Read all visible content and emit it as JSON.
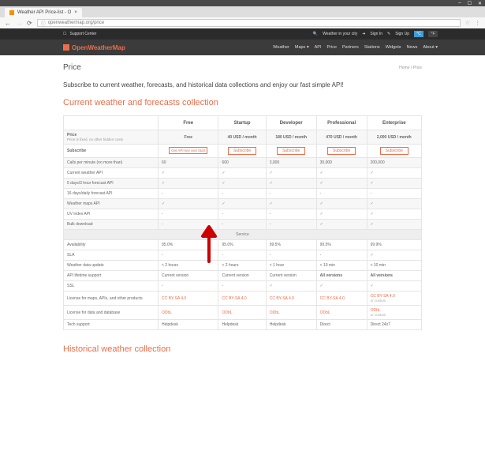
{
  "chrome": {
    "tab_title": "Weather API Price-list - O",
    "url": "openweathermap.org/price",
    "window_buttons": [
      "–",
      "☐",
      "✕"
    ]
  },
  "topbar": {
    "support": "Support Center",
    "weather_city": "Weather in your city",
    "signin": "Sign In",
    "signup": "Sign Up",
    "unit_c": "°C",
    "unit_f": "°F"
  },
  "logo": "OpenWeatherMap",
  "nav": [
    "Weather",
    "Maps ▾",
    "API",
    "Price",
    "Partners",
    "Stations",
    "Widgets",
    "News",
    "About ▾"
  ],
  "breadcrumb": {
    "title": "Price",
    "home": "Home",
    "current": "Price"
  },
  "intro": "Subscribe to current weather, forecasts, and historical data collections and enjoy our fast simple API!",
  "section1": "Current weather and forecasts collection",
  "section2": "Historical weather collection",
  "tiers": [
    "Free",
    "Startup",
    "Developer",
    "Professional",
    "Enterprise"
  ],
  "price_row": {
    "label": "Price",
    "note": "Price is fixed, no other hidden costs",
    "values": [
      "Free",
      "40 USD / month",
      "180 USD / month",
      "470 USD / month",
      "2,000 USD / month"
    ]
  },
  "subscribe_row": {
    "label": "Subscribe",
    "cta": "Get API key and Start",
    "btn": "Subscribe"
  },
  "rows1": [
    {
      "label": "Calls per minute (no more than)",
      "v": [
        "60",
        "600",
        "3,000",
        "30,000",
        "200,000"
      ]
    },
    {
      "label": "Current weather API",
      "v": [
        "✓",
        "✓",
        "✓",
        "✓",
        "✓"
      ]
    },
    {
      "label": "5 days/3 hour forecast API",
      "v": [
        "✓",
        "✓",
        "✓",
        "✓",
        "✓"
      ]
    },
    {
      "label": "16 days/daily forecast API",
      "v": [
        "-",
        "-",
        "-",
        "-",
        "-"
      ]
    },
    {
      "label": "Weather maps API",
      "v": [
        "✓",
        "✓",
        "✓",
        "✓",
        "✓"
      ]
    },
    {
      "label": "UV index API",
      "v": [
        "-",
        "-",
        "-",
        "✓",
        "✓"
      ]
    },
    {
      "label": "Bulk download",
      "v": [
        "-",
        "-",
        "-",
        "✓",
        "✓"
      ]
    }
  ],
  "service_label": "Service",
  "rows2": [
    {
      "label": "Availability",
      "v": [
        "95.0%",
        "95.0%",
        "99.5%",
        "99.5%",
        "99.9%"
      ]
    },
    {
      "label": "SLA",
      "v": [
        "-",
        "-",
        "-",
        "-",
        "✓"
      ]
    },
    {
      "label": "Weather data update",
      "v": [
        "< 2 hours",
        "< 2 hours",
        "< 1 hour",
        "< 10 min",
        "< 10 min"
      ]
    },
    {
      "label": "API lifetime support",
      "v": [
        "Current version",
        "Current version",
        "Current version",
        "All versions",
        "All versions"
      ],
      "bold_last2": true
    },
    {
      "label": "SSL",
      "v": [
        "-",
        "-",
        "✓",
        "✓",
        "✓"
      ]
    }
  ],
  "license_maps": {
    "label": "License for maps, APIs, and other products",
    "v": [
      "CC BY-SA 4.0",
      "CC BY-SA 4.0",
      "CC BY-SA 4.0",
      "CC BY-SA 4.0",
      "CC BY-SA 4.0"
    ],
    "note_last": "or custom"
  },
  "license_data": {
    "label": "License for data and database",
    "v": [
      "ODbL",
      "ODbL",
      "ODbL",
      "ODbL",
      "ODbL"
    ],
    "note_last": "or custom"
  },
  "tech_support": {
    "label": "Tech support",
    "v": [
      "Helpdesk",
      "Helpdesk",
      "Helpdesk",
      "Direct",
      "Direct 24x7"
    ]
  }
}
